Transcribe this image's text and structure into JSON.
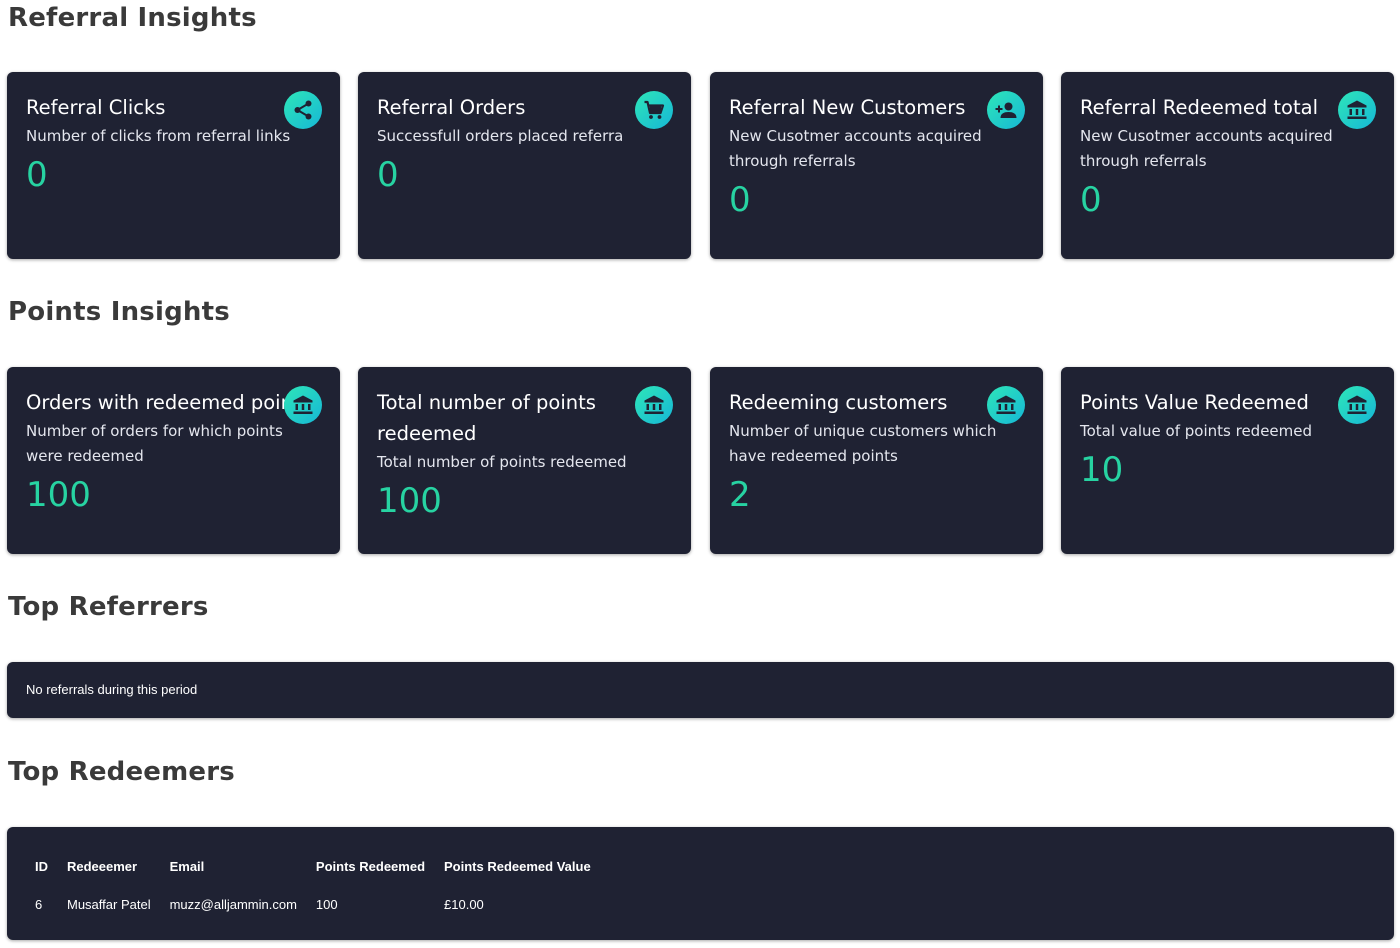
{
  "sections": {
    "referral_title": "Referral Insights",
    "points_title": "Points Insights",
    "top_referrers_title": "Top Referrers",
    "top_redeemers_title": "Top Redeemers"
  },
  "referral_cards": [
    {
      "title": "Referral Clicks",
      "description": "Number of clicks from referral links",
      "value": "0",
      "icon": "share-icon"
    },
    {
      "title": "Referral Orders",
      "description": "Successfull orders placed referra",
      "value": "0",
      "icon": "cart-icon"
    },
    {
      "title": "Referral New Customers",
      "description": "New Cusotmer accounts acquired through referrals",
      "value": "0",
      "icon": "add-user-icon"
    },
    {
      "title": "Referral Redeemed total",
      "description": "New Cusotmer accounts acquired through referrals",
      "value": "0",
      "icon": "bank-icon"
    }
  ],
  "points_cards": [
    {
      "title": "Orders with redeemed points",
      "description": "Number of orders for which points were redeemed",
      "value": "100",
      "icon": "bank-icon"
    },
    {
      "title": "Total number of points redeemed",
      "description": "Total number of points redeemed",
      "value": "100",
      "icon": "bank-icon"
    },
    {
      "title": "Redeeming customers",
      "description": "Number of unique customers which have redeemed points",
      "value": "2",
      "icon": "bank-icon"
    },
    {
      "title": "Points Value Redeemed",
      "description": "Total value of points redeemed",
      "value": "10",
      "icon": "bank-icon"
    }
  ],
  "top_referrers": {
    "empty_message": "No referrals during this period"
  },
  "top_redeemers": {
    "columns": [
      "ID",
      "Redeeemer",
      "Email",
      "Points Redeemed",
      "Points Redeemed Value"
    ],
    "rows": [
      {
        "id": "6",
        "name": "Musaffar Patel",
        "email": "muzz@alljammin.com",
        "points": "100",
        "value": "£10.00"
      }
    ]
  },
  "colors": {
    "card_background": "#1f2233",
    "value_accent": "#27d3a2",
    "icon_gradient_start": "#2ee6b8",
    "icon_gradient_end": "#16b7d6",
    "heading_text": "#3a3a3a"
  }
}
